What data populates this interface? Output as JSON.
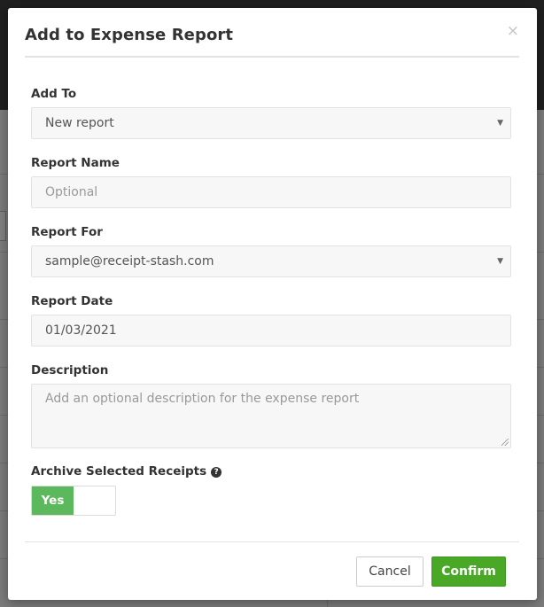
{
  "modal": {
    "title": "Add to Expense Report",
    "close_icon": "×",
    "add_to": {
      "label": "Add To",
      "value": "New report"
    },
    "report_name": {
      "label": "Report Name",
      "placeholder": "Optional"
    },
    "report_for": {
      "label": "Report For",
      "value": "sample@receipt-stash.com"
    },
    "report_date": {
      "label": "Report Date",
      "value": "01/03/2021"
    },
    "description": {
      "label": "Description",
      "placeholder": "Add an optional description for the expense report"
    },
    "archive": {
      "label": "Archive Selected Receipts",
      "help_icon": "?",
      "toggle_label": "Yes"
    },
    "buttons": {
      "cancel": "Cancel",
      "confirm": "Confirm"
    }
  },
  "caret_glyph": "▼",
  "colors": {
    "confirm": "#4aa827",
    "toggle_on": "#5cb85c",
    "backdrop": "#7b7b7b"
  }
}
